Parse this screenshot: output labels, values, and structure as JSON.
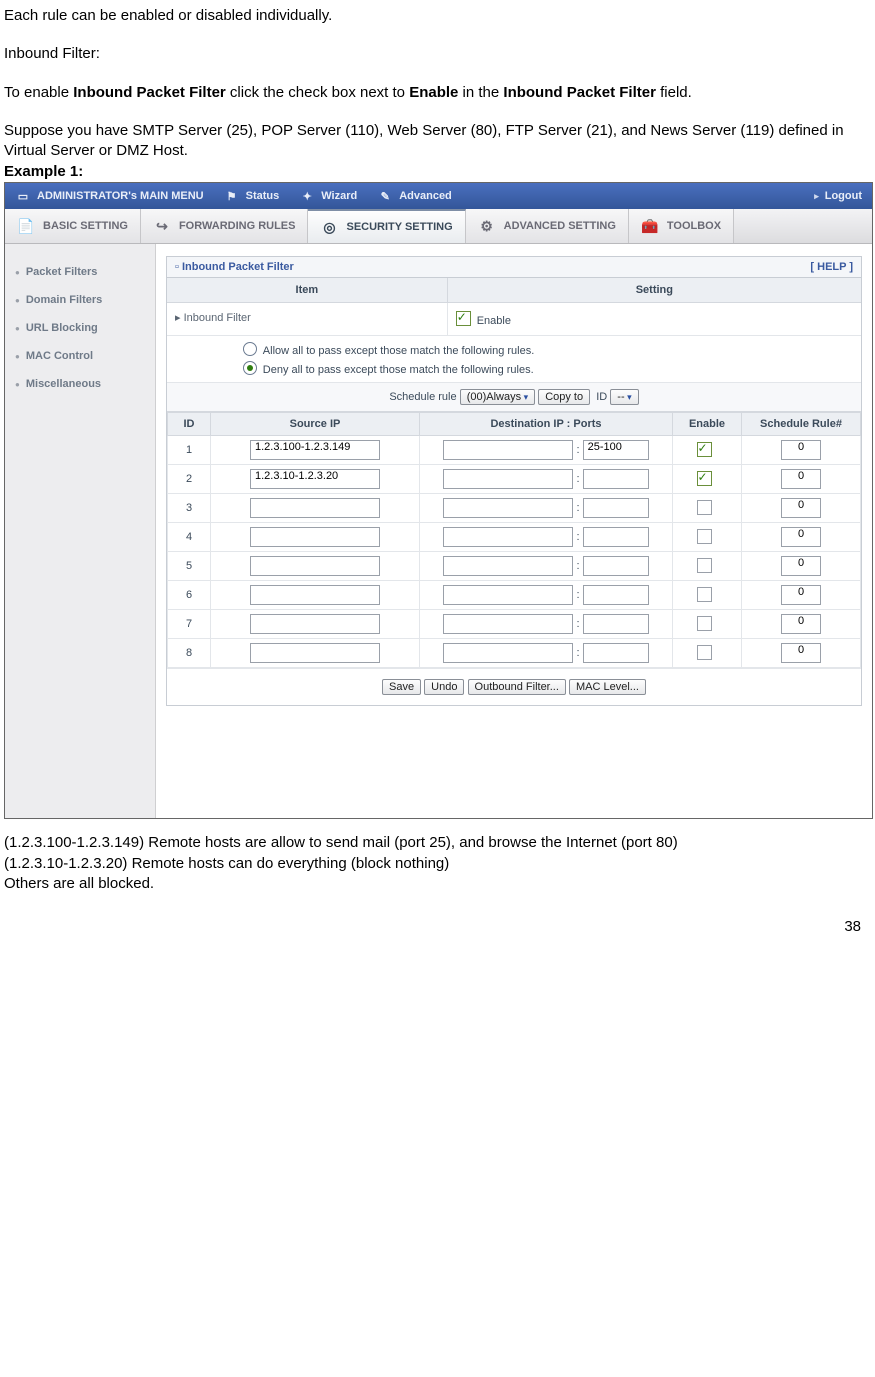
{
  "doc": {
    "p1": "Each rule can be enabled or disabled individually.",
    "p2": "Inbound Filter:",
    "p3a": "To enable ",
    "p3b": "Inbound Packet Filter",
    "p3c": " click the check box next to ",
    "p3d": "Enable",
    "p3e": " in the ",
    "p3f": "Inbound Packet Filter",
    "p3g": " field.",
    "p4": "Suppose you have SMTP Server (25), POP Server (110), Web Server (80), FTP Server (21), and News Server (119) defined in Virtual Server or DMZ Host.",
    "ex": "Example 1:",
    "after1": "(1.2.3.100-1.2.3.149) Remote hosts are allow to send mail (port 25), and browse the Internet (port 80)",
    "after2": "(1.2.3.10-1.2.3.20) Remote hosts can do everything (block nothing)",
    "after3": "Others are all blocked.",
    "page": "38"
  },
  "topbar": {
    "title": "ADMINISTRATOR's MAIN MENU",
    "status": "Status",
    "wizard": "Wizard",
    "advanced": "Advanced",
    "logout": "Logout"
  },
  "tabs": {
    "basic": "BASIC SETTING",
    "forward": "FORWARDING RULES",
    "security": "SECURITY SETTING",
    "advsetting": "ADVANCED SETTING",
    "toolbox": "TOOLBOX"
  },
  "sidebar": {
    "items": [
      {
        "label": "Packet Filters"
      },
      {
        "label": "Domain Filters"
      },
      {
        "label": "URL Blocking"
      },
      {
        "label": "MAC Control"
      },
      {
        "label": "Miscellaneous"
      }
    ]
  },
  "panel": {
    "title": "Inbound Packet Filter",
    "help": "[ HELP ]",
    "h_item": "Item",
    "h_setting": "Setting",
    "row_lbl": "Inbound Filter",
    "row_chk": "Enable",
    "opt_allow": "Allow all to pass except those match the following rules.",
    "opt_deny": "Deny all to pass except those match the following rules.",
    "sched_lbl": "Schedule rule",
    "sched_val": "(00)Always",
    "copy_btn": "Copy to",
    "id_lbl": "ID",
    "id_val": "--"
  },
  "table": {
    "cols": {
      "id": "ID",
      "src": "Source IP",
      "dst": "Destination IP : Ports",
      "en": "Enable",
      "sr": "Schedule Rule#"
    },
    "rows": [
      {
        "id": "1",
        "src": "1.2.3.100-1.2.3.149",
        "dst": "",
        "port": "25-100",
        "en": true,
        "sr": "0"
      },
      {
        "id": "2",
        "src": "1.2.3.10-1.2.3.20",
        "dst": "",
        "port": "",
        "en": true,
        "sr": "0"
      },
      {
        "id": "3",
        "src": "",
        "dst": "",
        "port": "",
        "en": false,
        "sr": "0"
      },
      {
        "id": "4",
        "src": "",
        "dst": "",
        "port": "",
        "en": false,
        "sr": "0"
      },
      {
        "id": "5",
        "src": "",
        "dst": "",
        "port": "",
        "en": false,
        "sr": "0"
      },
      {
        "id": "6",
        "src": "",
        "dst": "",
        "port": "",
        "en": false,
        "sr": "0"
      },
      {
        "id": "7",
        "src": "",
        "dst": "",
        "port": "",
        "en": false,
        "sr": "0"
      },
      {
        "id": "8",
        "src": "",
        "dst": "",
        "port": "",
        "en": false,
        "sr": "0"
      }
    ]
  },
  "buttons": {
    "save": "Save",
    "undo": "Undo",
    "out": "Outbound Filter...",
    "mac": "MAC Level..."
  }
}
